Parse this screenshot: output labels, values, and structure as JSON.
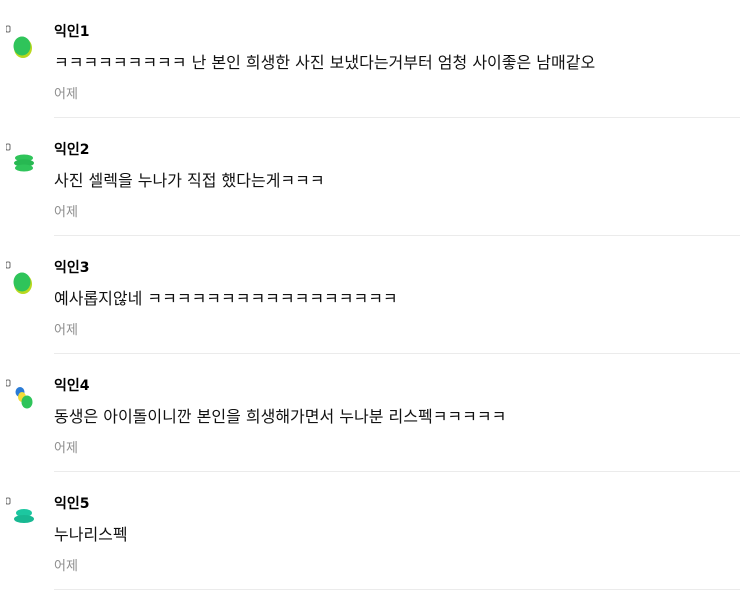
{
  "comments": [
    {
      "author": "익인1",
      "text": "ㅋㅋㅋㅋㅋㅋㅋㅋㅋ 난 본인 희생한 사진 보냈다는거부터 엄청 사이좋은 남매같오",
      "time": "어제",
      "avatar_icon": "green-blob-avatar-icon"
    },
    {
      "author": "익인2",
      "text": "사진 셀렉을 누나가 직접 했다는게ㅋㅋㅋ",
      "time": "어제",
      "avatar_icon": "green-stack-avatar-icon"
    },
    {
      "author": "익인3",
      "text": "예사롭지않네 ㅋㅋㅋㅋㅋㅋㅋㅋㅋㅋㅋㅋㅋㅋㅋㅋㅋ",
      "time": "어제",
      "avatar_icon": "green-blob-avatar-icon"
    },
    {
      "author": "익인4",
      "text": "동생은 아이돌이니깐 본인을 희생해가면서 누나분 리스펙ㅋㅋㅋㅋㅋ",
      "time": "어제",
      "avatar_icon": "blue-yellow-avatar-icon"
    },
    {
      "author": "익인5",
      "text": "누나리스펙",
      "time": "어제",
      "avatar_icon": "teal-stack-avatar-icon"
    }
  ],
  "colors": {
    "avatar_green": "#2fc45a",
    "avatar_lime": "#b9d81e",
    "avatar_teal": "#1cc7a0",
    "avatar_blue": "#2a7bd6",
    "avatar_yellow": "#f2dc3a",
    "time_gray": "#8e8e8e",
    "divider": "#ebebeb"
  }
}
